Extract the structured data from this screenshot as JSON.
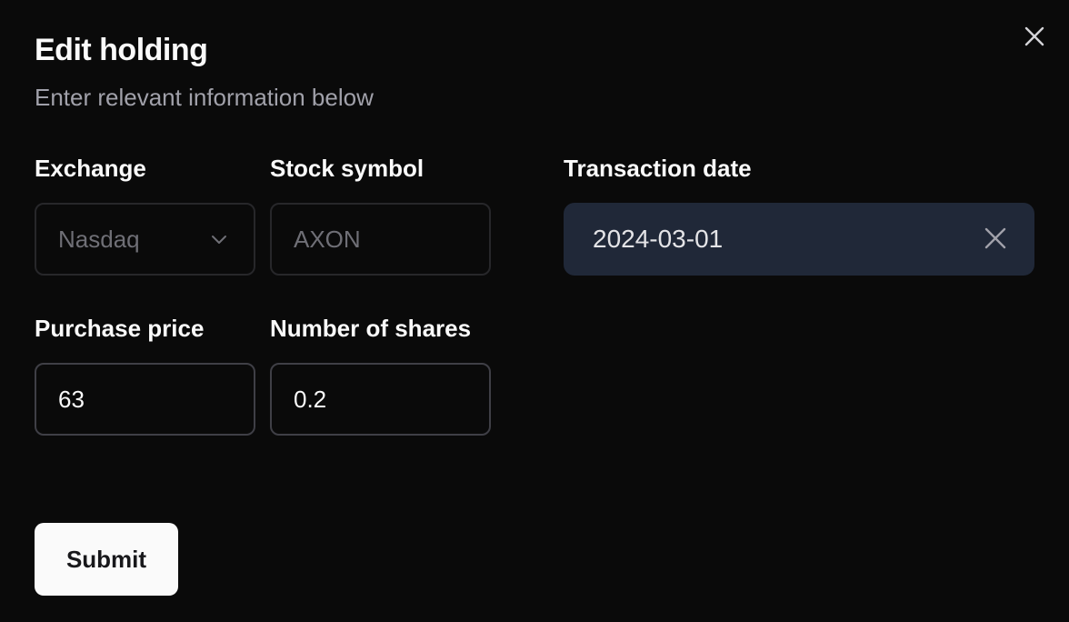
{
  "dialog": {
    "title": "Edit holding",
    "subtitle": "Enter relevant information below",
    "close_icon": "close-icon"
  },
  "form": {
    "exchange": {
      "label": "Exchange",
      "value": "Nasdaq",
      "icon": "chevron-down-icon"
    },
    "stock_symbol": {
      "label": "Stock symbol",
      "value": "AXON"
    },
    "transaction_date": {
      "label": "Transaction date",
      "value": "2024-03-01",
      "clear_icon": "close-icon"
    },
    "purchase_price": {
      "label": "Purchase price",
      "value": "63"
    },
    "number_of_shares": {
      "label": "Number of shares",
      "value": "0.2"
    },
    "submit_label": "Submit"
  },
  "colors": {
    "background": "#0a0a0a",
    "border": "#27272a",
    "muted_text": "#a1a1aa",
    "date_field_bg": "#202838",
    "primary_button_bg": "#fafafa"
  }
}
